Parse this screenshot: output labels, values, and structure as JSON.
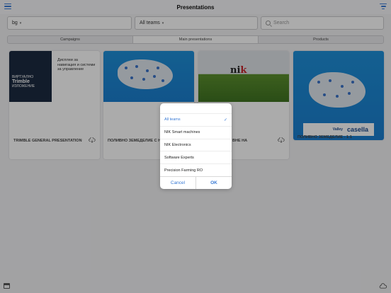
{
  "header": {
    "title": "Presentations"
  },
  "filters": {
    "country": "bg",
    "team": "All teams",
    "search_placeholder": "Search"
  },
  "tabs": [
    "Campaigns",
    "Main presentations",
    "Products"
  ],
  "active_tab": "Main presentations",
  "cards": [
    {
      "caption": "TRIMBLE GENERAL PRESENTATION",
      "thumb_big": "Trimble",
      "thumb_top": "ВИРТУАЛНО",
      "thumb_bottom": "ИЗЛОЖЕНИЕ",
      "thumb_side": "Дисплеи за навигация и системи за управление"
    },
    {
      "caption": "ПОЛИВНО ЗЕМЕДЕЛИЕ С Н"
    },
    {
      "caption": "ВНЕ НА",
      "logo_main": "ni",
      "logo_accent": "k"
    },
    {
      "caption": "ПОЛИВНО ЗЕМЕДЕЛИЕ - 1:1",
      "brand": "casella",
      "brand_left": "Valley"
    }
  ],
  "team_picker": {
    "options": [
      "All teams",
      "NIK Smart machines",
      "NIK Electronics",
      "Software Experts",
      "Precision Farming RO"
    ],
    "selected": "All teams",
    "cancel": "Cancel",
    "ok": "OK"
  },
  "colors": {
    "accent": "#3a7bd5",
    "map_blue": "#1e8fd8",
    "trimble_navy": "#1c2b41"
  }
}
